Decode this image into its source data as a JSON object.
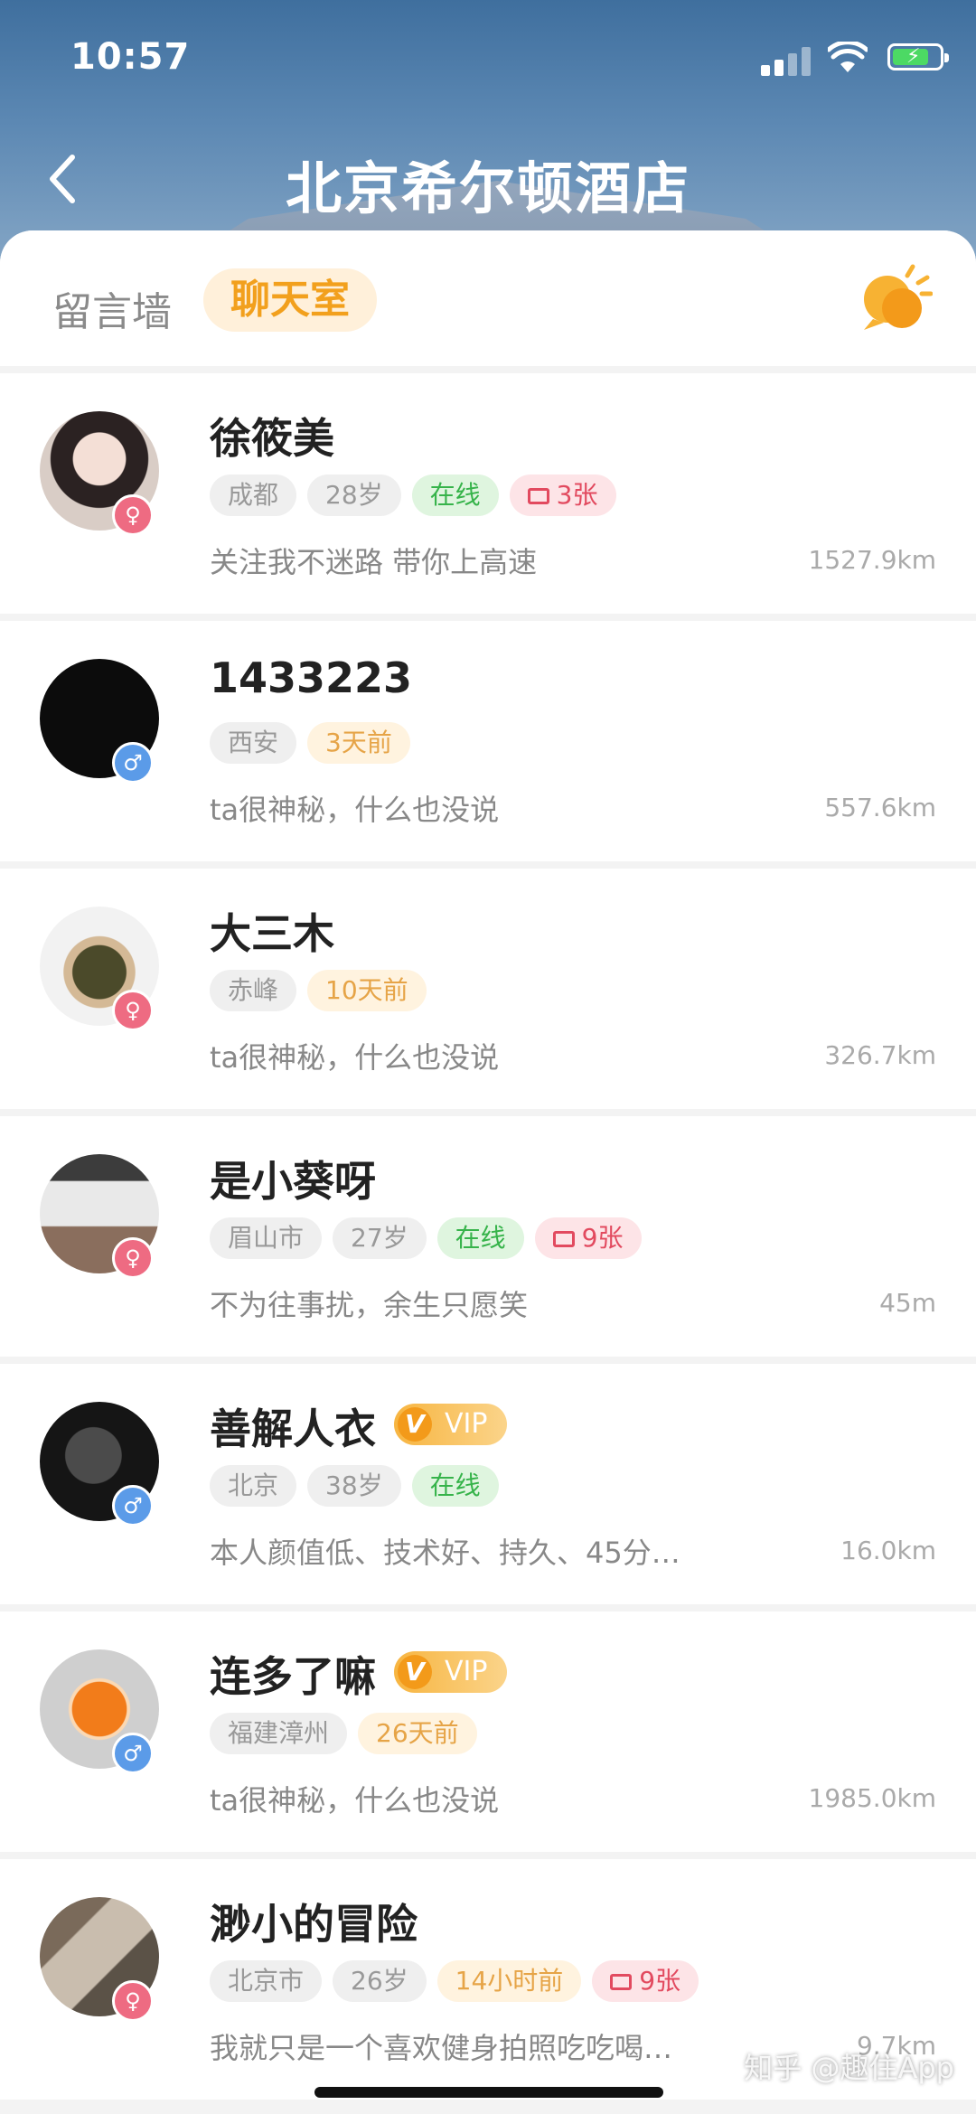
{
  "status_bar": {
    "time": "10:57"
  },
  "header": {
    "title": "北京希尔顿酒店"
  },
  "tabs": {
    "wall": "留言墙",
    "chat": "聊天室"
  },
  "users": [
    {
      "name": "徐筱美",
      "gender": "female",
      "vip": false,
      "tags": [
        {
          "text": "成都",
          "style": "gray"
        },
        {
          "text": "28岁",
          "style": "gray"
        },
        {
          "text": "在线",
          "style": "green"
        },
        {
          "text": "3张",
          "style": "red",
          "icon": "photo-icon"
        }
      ],
      "bio": "关注我不迷路 带你上高速",
      "distance": "1527.9km"
    },
    {
      "name": "1433223",
      "gender": "male",
      "vip": false,
      "tags": [
        {
          "text": "西安",
          "style": "gray"
        },
        {
          "text": "3天前",
          "style": "orange"
        }
      ],
      "bio": "ta很神秘，什么也没说",
      "distance": "557.6km"
    },
    {
      "name": "大三木",
      "gender": "female",
      "vip": false,
      "tags": [
        {
          "text": "赤峰",
          "style": "gray"
        },
        {
          "text": "10天前",
          "style": "orange"
        }
      ],
      "bio": "ta很神秘，什么也没说",
      "distance": "326.7km"
    },
    {
      "name": "是小葵呀",
      "gender": "female",
      "vip": false,
      "tags": [
        {
          "text": "眉山市",
          "style": "gray"
        },
        {
          "text": "27岁",
          "style": "gray"
        },
        {
          "text": "在线",
          "style": "green"
        },
        {
          "text": "9张",
          "style": "red",
          "icon": "photo-icon"
        }
      ],
      "bio": "不为往事扰，余生只愿笑",
      "distance": "45m"
    },
    {
      "name": "善解人衣",
      "gender": "male",
      "vip": true,
      "tags": [
        {
          "text": "北京",
          "style": "gray"
        },
        {
          "text": "38岁",
          "style": "gray"
        },
        {
          "text": "在线",
          "style": "green"
        }
      ],
      "bio": "本人颜值低、技术好、持久、45分…",
      "distance": "16.0km"
    },
    {
      "name": "连多了嘛",
      "gender": "male",
      "vip": true,
      "tags": [
        {
          "text": "福建漳州",
          "style": "gray"
        },
        {
          "text": "26天前",
          "style": "orange"
        }
      ],
      "bio": "ta很神秘，什么也没说",
      "distance": "1985.0km"
    },
    {
      "name": "渺小的冒险",
      "gender": "female",
      "vip": false,
      "tags": [
        {
          "text": "北京市",
          "style": "gray"
        },
        {
          "text": "26岁",
          "style": "gray"
        },
        {
          "text": "14小时前",
          "style": "orange"
        },
        {
          "text": "9张",
          "style": "red",
          "icon": "photo-icon"
        }
      ],
      "bio": "我就只是一个喜欢健身拍照吃吃喝…",
      "distance": "9.7km"
    }
  ],
  "vip_label": "VIP",
  "vip_letter": "V",
  "watermark": "知乎 @趣住App",
  "colors": {
    "accent": "#f2a01d",
    "online": "#36b34a",
    "female": "#ee6b82",
    "male": "#5b9be8"
  }
}
